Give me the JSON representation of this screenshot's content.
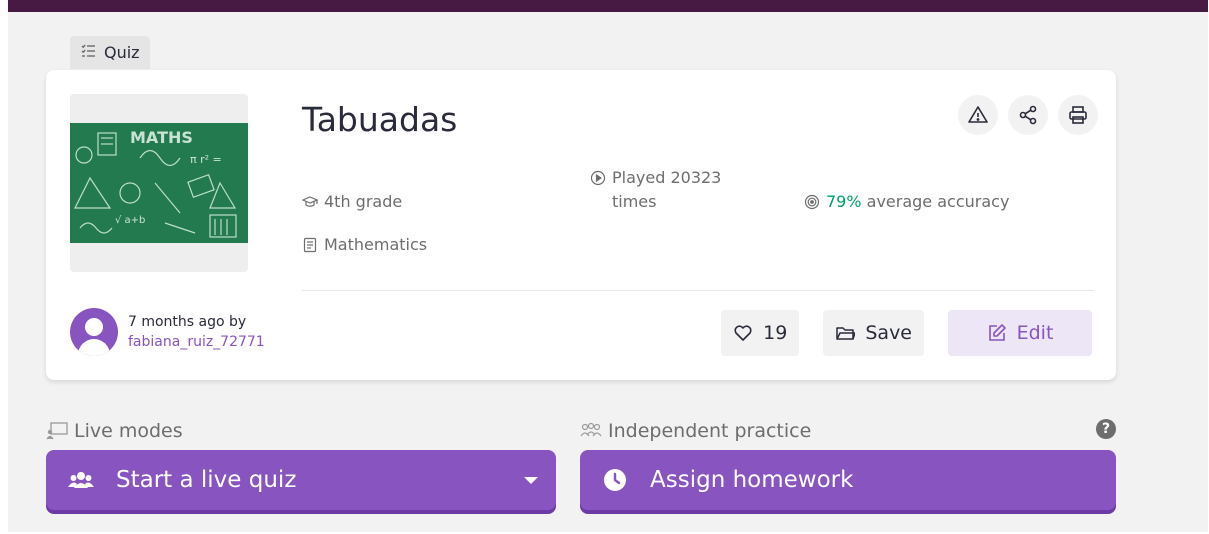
{
  "colors": {
    "top_bar": "#461a42",
    "brand_purple": "#8854c0",
    "accuracy_green": "#00a06a"
  },
  "header": {
    "type_label": "Quiz",
    "type_icon": "list-icon"
  },
  "quiz": {
    "title": "Tabuadas",
    "thumbnail_alt_text": "MATHS",
    "grade": "4th grade",
    "subject": "Mathematics",
    "played_label": "Played 20323 times",
    "accuracy_value": "79%",
    "accuracy_label": " average accuracy",
    "author_when": "7 months ago by",
    "author_name": "fabiana_ruiz_72771"
  },
  "card_actions": {
    "report_icon": "warning-icon",
    "share_icon": "share-icon",
    "print_icon": "print-icon"
  },
  "buttons": {
    "likes_count": "19",
    "save_label": "Save",
    "edit_label": "Edit"
  },
  "live_modes": {
    "label": "Live modes",
    "start_label": "Start a live quiz"
  },
  "independent": {
    "label": "Independent practice",
    "assign_label": "Assign homework"
  }
}
